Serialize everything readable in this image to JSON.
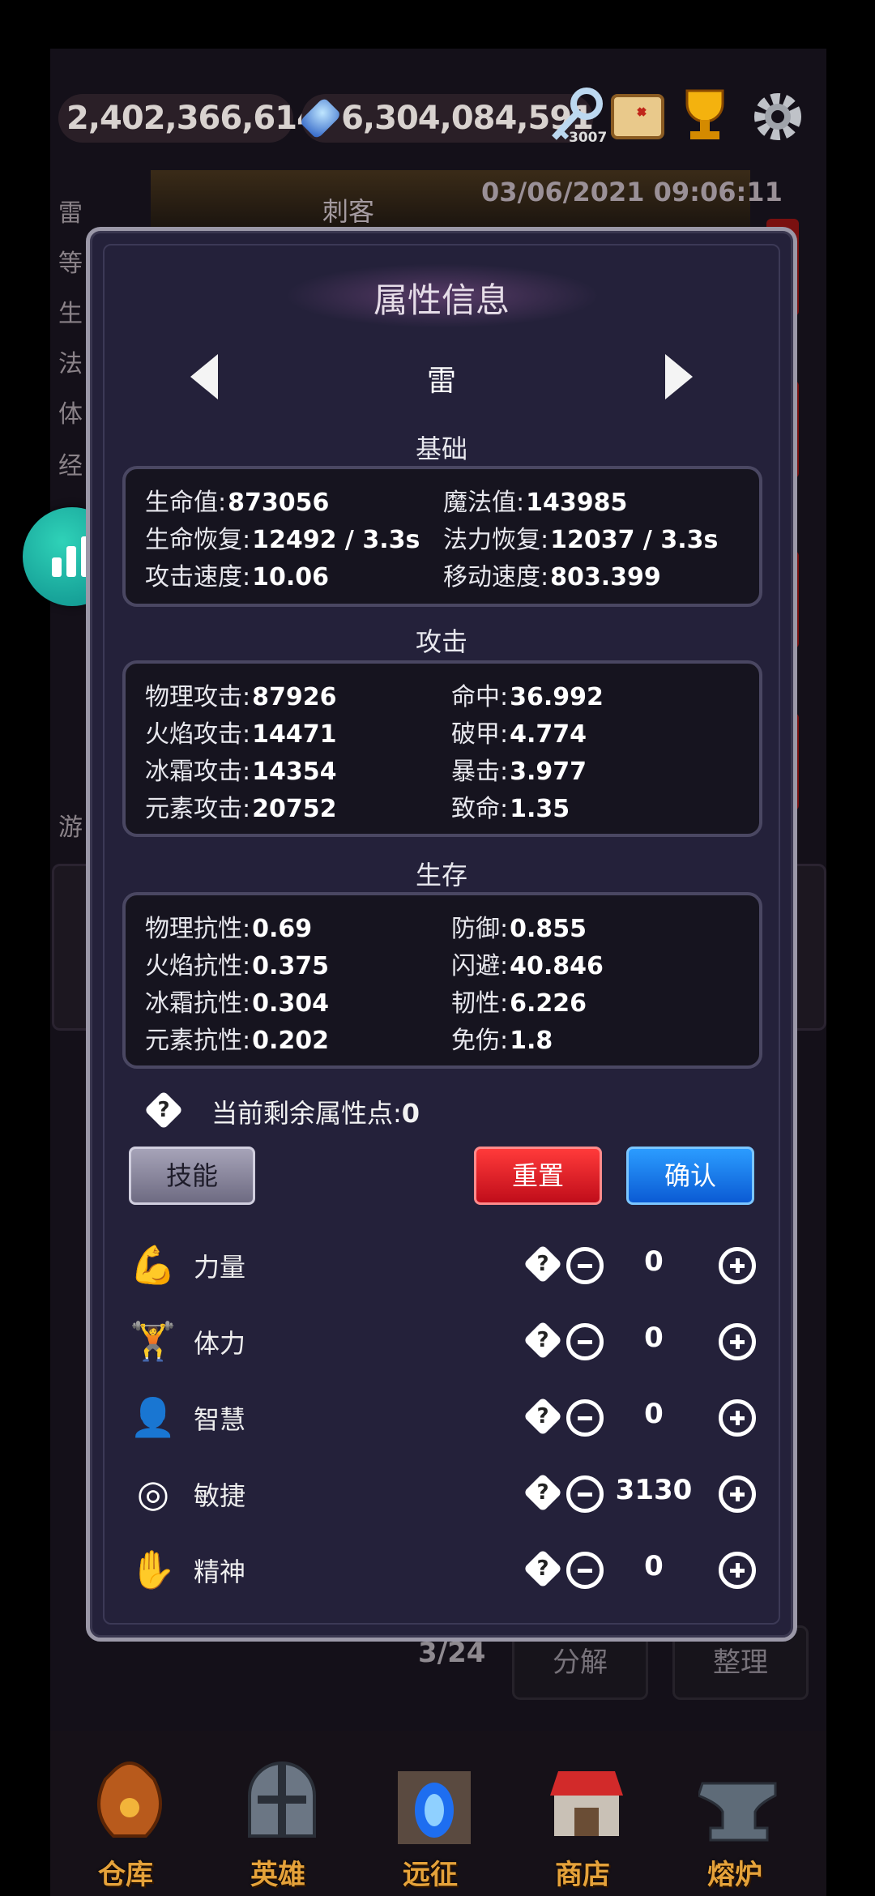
{
  "top_bar": {
    "gold": "2,402,366,614",
    "gems": "6,304,084,591",
    "keys": "3007",
    "icons": [
      "coin-icon",
      "gem-icon",
      "key-icon",
      "map-icon",
      "trophy-icon",
      "gear-icon"
    ]
  },
  "background": {
    "tab_label": "刺客",
    "datetime": "03/06/2021 09:06:11",
    "side_labels": [
      "雷",
      "等",
      "生",
      "法",
      "体",
      "经",
      "游"
    ],
    "inventory_count": "3/24",
    "decompose_label": "分解",
    "sort_label": "整理"
  },
  "modal": {
    "title": "属性信息",
    "character_name": "雷",
    "sections": {
      "basic": {
        "title": "基础",
        "rows": [
          {
            "label": "生命值:",
            "value": "873056",
            "label2": "魔法值:",
            "value2": "143985"
          },
          {
            "label": "生命恢复:",
            "value": "12492 / 3.3s",
            "label2": "法力恢复:",
            "value2": "12037 / 3.3s"
          },
          {
            "label": "攻击速度:",
            "value": "10.06",
            "label2": "移动速度:",
            "value2": "803.399"
          }
        ]
      },
      "attack": {
        "title": "攻击",
        "rows": [
          {
            "label": "物理攻击:",
            "value": "87926",
            "label2": "命中:",
            "value2": "36.992"
          },
          {
            "label": "火焰攻击:",
            "value": "14471",
            "label2": "破甲:",
            "value2": "4.774"
          },
          {
            "label": "冰霜攻击:",
            "value": "14354",
            "label2": "暴击:",
            "value2": "3.977"
          },
          {
            "label": "元素攻击:",
            "value": "20752",
            "label2": "致命:",
            "value2": "1.35"
          }
        ]
      },
      "survival": {
        "title": "生存",
        "rows": [
          {
            "label": "物理抗性:",
            "value": "0.69",
            "label2": "防御:",
            "value2": "0.855"
          },
          {
            "label": "火焰抗性:",
            "value": "0.375",
            "label2": "闪避:",
            "value2": "40.846"
          },
          {
            "label": "冰霜抗性:",
            "value": "0.304",
            "label2": "韧性:",
            "value2": "6.226"
          },
          {
            "label": "元素抗性:",
            "value": "0.202",
            "label2": "免伤:",
            "value2": "1.8"
          }
        ]
      }
    },
    "points_label": "当前剩余属性点:",
    "points_value": "0",
    "buttons": {
      "skills": "技能",
      "reset": "重置",
      "confirm": "确认"
    },
    "attributes": [
      {
        "name": "力量",
        "value": "0",
        "icon": "strength-icon"
      },
      {
        "name": "体力",
        "value": "0",
        "icon": "stamina-icon"
      },
      {
        "name": "智慧",
        "value": "0",
        "icon": "wisdom-icon"
      },
      {
        "name": "敏捷",
        "value": "3130",
        "icon": "agility-icon"
      },
      {
        "name": "精神",
        "value": "0",
        "icon": "spirit-icon"
      }
    ]
  },
  "nav": [
    {
      "label": "仓库",
      "icon": "warehouse-bag-icon"
    },
    {
      "label": "英雄",
      "icon": "hero-helmet-icon"
    },
    {
      "label": "远征",
      "icon": "expedition-portal-icon"
    },
    {
      "label": "商店",
      "icon": "shop-icon"
    },
    {
      "label": "熔炉",
      "icon": "anvil-icon"
    }
  ],
  "colors": {
    "modal_bg": "#24213a",
    "reset": "#e0141f",
    "confirm": "#1a74e8",
    "nav_label": "#e5a23a"
  }
}
